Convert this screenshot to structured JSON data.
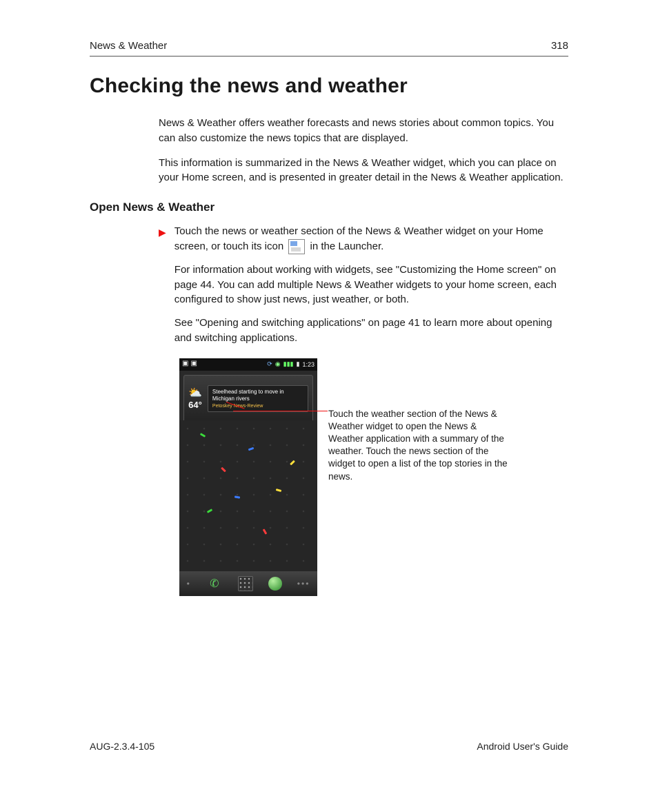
{
  "header": {
    "section": "News & Weather",
    "page_number": "318"
  },
  "title": "Checking the news and weather",
  "intro": {
    "p1": "News & Weather offers weather forecasts and news stories about common topics. You can also customize the news topics that are displayed.",
    "p2": "This information is summarized in the News & Weather widget, which you can place on your Home screen, and is presented in greater detail in the News & Weather application."
  },
  "subhead": "Open News & Weather",
  "bullet": {
    "line1a": "Touch the news or weather section of the News & Weather widget on your Home screen, or touch its icon ",
    "line1b": " in the Launcher.",
    "line2": "For information about working with widgets, see \"Customizing the Home screen\" on page 44. You can add multiple News & Weather widgets to your home screen, each configured to show just news, just weather, or both.",
    "line3": "See \"Opening and switching applications\" on page 41 to learn more about opening and switching applications."
  },
  "screenshot": {
    "status_time": "1:23",
    "widget": {
      "temp": "64°",
      "headline": "Steelhead starting to move in Michigan rivers",
      "source": "Petoskey News-Review"
    }
  },
  "caption": "Touch the weather section of the News & Weather widget to open the News & Weather application with a summary of the weather. Touch the news section of the widget to open a list of the top stories in the news.",
  "footer": {
    "left": "AUG-2.3.4-105",
    "right": "Android User's Guide"
  }
}
